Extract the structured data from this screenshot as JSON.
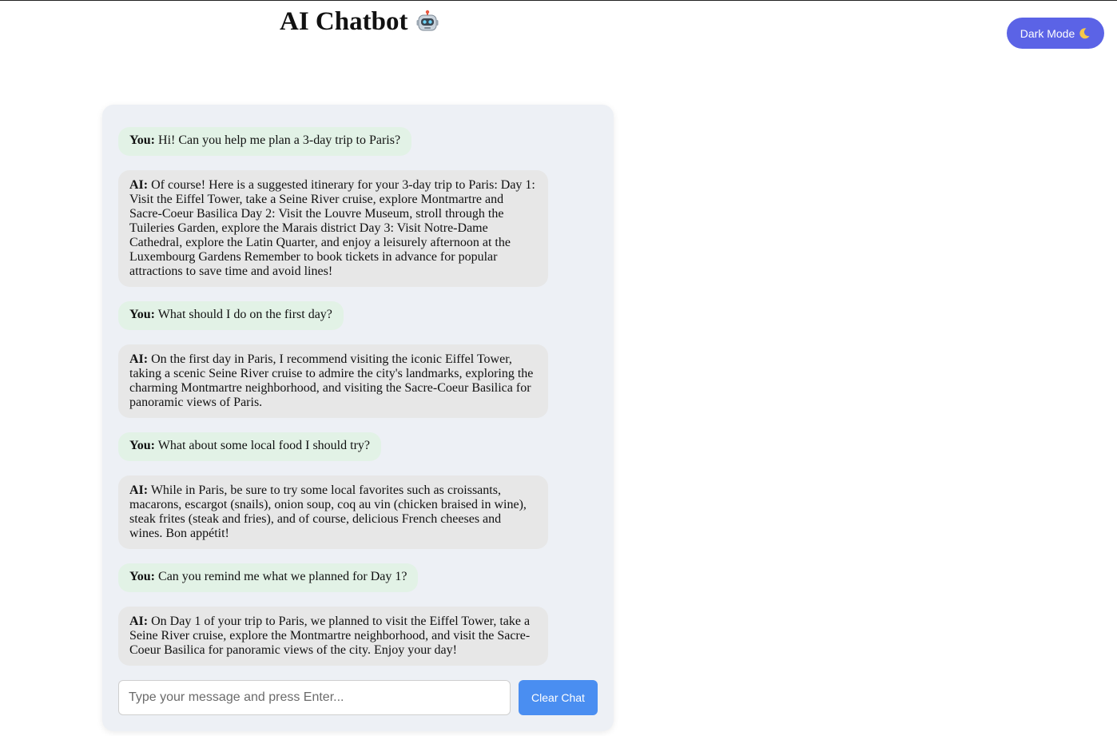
{
  "header": {
    "title": "AI Chatbot",
    "title_icon": "robot-icon",
    "theme_button_label": "Dark Mode",
    "theme_button_icon": "moon-icon"
  },
  "colors": {
    "theme_button": "#5b63e6",
    "user_bubble": "#e2f2e6",
    "ai_bubble": "#e7e7e7",
    "chat_panel": "#edf0f5",
    "clear_button": "#4a8ef1"
  },
  "messages": [
    {
      "speaker": "You:",
      "role": "user",
      "text": "Hi! Can you help me plan a 3-day trip to Paris?"
    },
    {
      "speaker": "AI:",
      "role": "ai",
      "text": "Of course! Here is a suggested itinerary for your 3-day trip to Paris: Day 1: Visit the Eiffel Tower, take a Seine River cruise, explore Montmartre and Sacre-Coeur Basilica Day 2: Visit the Louvre Museum, stroll through the Tuileries Garden, explore the Marais district Day 3: Visit Notre-Dame Cathedral, explore the Latin Quarter, and enjoy a leisurely afternoon at the Luxembourg Gardens Remember to book tickets in advance for popular attractions to save time and avoid lines!"
    },
    {
      "speaker": "You:",
      "role": "user",
      "text": "What should I do on the first day?"
    },
    {
      "speaker": "AI:",
      "role": "ai",
      "text": "On the first day in Paris, I recommend visiting the iconic Eiffel Tower, taking a scenic Seine River cruise to admire the city's landmarks, exploring the charming Montmartre neighborhood, and visiting the Sacre-Coeur Basilica for panoramic views of Paris."
    },
    {
      "speaker": "You:",
      "role": "user",
      "text": "What about some local food I should try?"
    },
    {
      "speaker": "AI:",
      "role": "ai",
      "text": "While in Paris, be sure to try some local favorites such as croissants, macarons, escargot (snails), onion soup, coq au vin (chicken braised in wine), steak frites (steak and fries), and of course, delicious French cheeses and wines. Bon appétit!"
    },
    {
      "speaker": "You:",
      "role": "user",
      "text": "Can you remind me what we planned for Day 1?"
    },
    {
      "speaker": "AI:",
      "role": "ai",
      "text": "On Day 1 of your trip to Paris, we planned to visit the Eiffel Tower, take a Seine River cruise, explore the Montmartre neighborhood, and visit the Sacre-Coeur Basilica for panoramic views of the city. Enjoy your day!"
    }
  ],
  "composer": {
    "placeholder": "Type your message and press Enter...",
    "value": "",
    "clear_label": "Clear Chat"
  }
}
